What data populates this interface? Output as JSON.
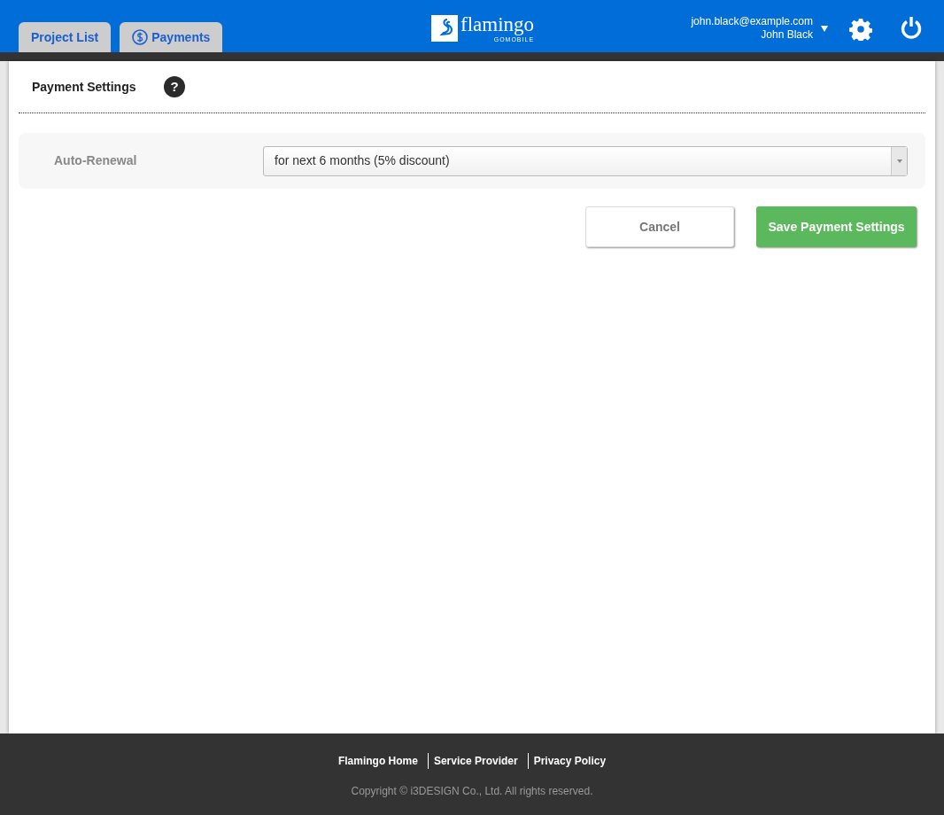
{
  "header": {
    "tabs": [
      {
        "label": "Project List",
        "kind": "plain"
      },
      {
        "label": "Payments",
        "kind": "dollar"
      }
    ],
    "logo": {
      "name": "flamingo",
      "tagline": "GOMOBILE"
    },
    "user": {
      "email": "john.black@example.com",
      "name": "John Black"
    }
  },
  "page": {
    "title": "Payment Settings",
    "help_icon": "?",
    "form": {
      "label": "Auto-Renewal",
      "value": "for next 6 months (5% discount)"
    },
    "buttons": [
      {
        "label": "Cancel",
        "kind": "secondary"
      },
      {
        "label": "Save Payment Settings",
        "kind": "primary"
      }
    ]
  },
  "footer": {
    "links": [
      "Flamingo Home",
      "Service Provider",
      "Privacy Policy"
    ],
    "copyright": "Copyright © i3DESIGN Co., Ltd. All rights reserved."
  }
}
